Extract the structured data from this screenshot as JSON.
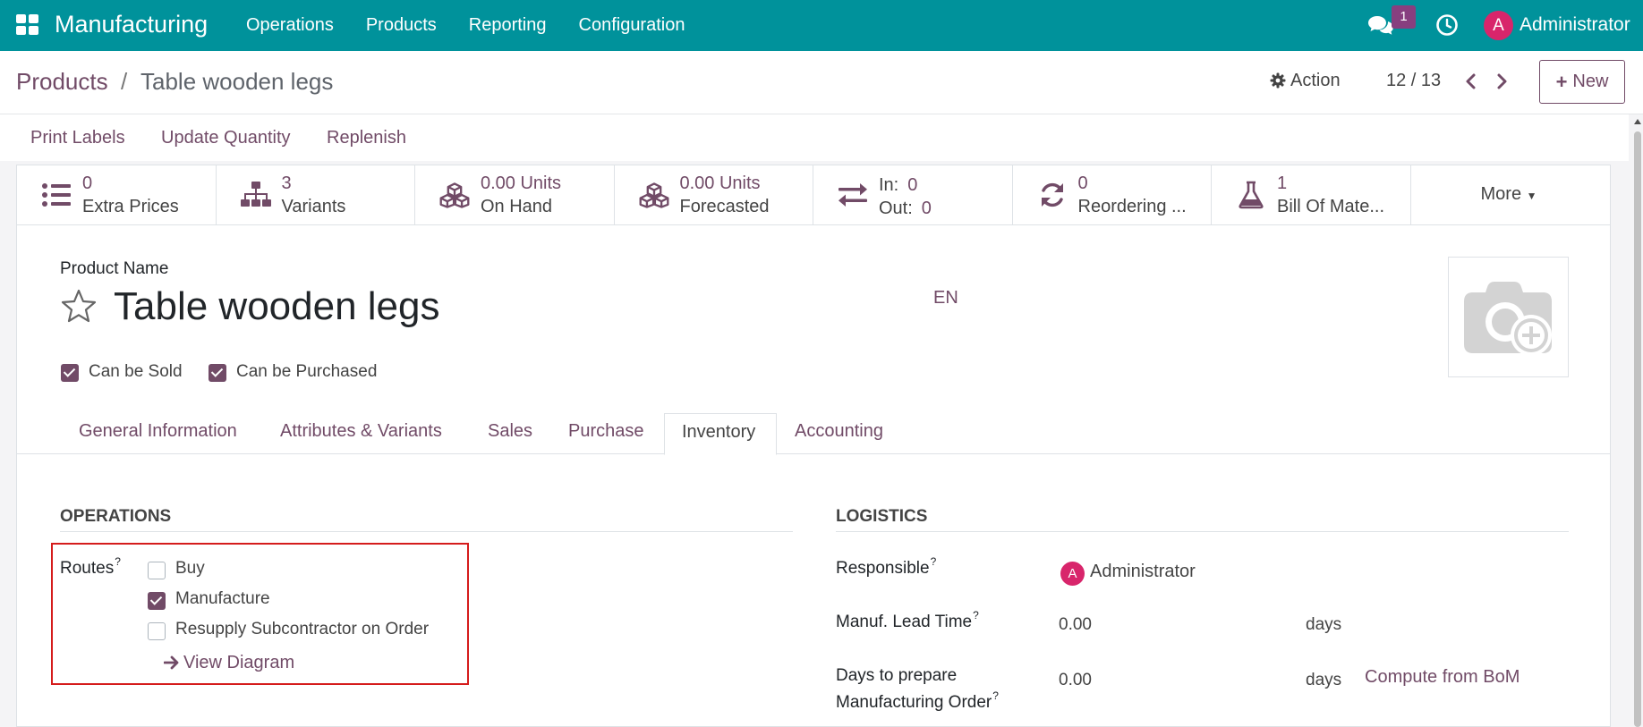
{
  "navbar": {
    "app_name": "Manufacturing",
    "menu": [
      "Operations",
      "Products",
      "Reporting",
      "Configuration"
    ],
    "chat_badge": "1",
    "avatar_letter": "A",
    "user_name": "Administrator",
    "bg_color": "#00929b"
  },
  "breadcrumb": {
    "parent": "Products",
    "separator": "/",
    "current": "Table wooden legs"
  },
  "controls": {
    "action_label": "Action",
    "pager": "12 / 13",
    "new_label": "New"
  },
  "statusbar": {
    "buttons": [
      "Print Labels",
      "Update Quantity",
      "Replenish"
    ]
  },
  "smart_buttons": [
    {
      "icon": "list-icon",
      "value": "0",
      "label": "Extra Prices"
    },
    {
      "icon": "sitemap-icon",
      "value": "3",
      "label": "Variants"
    },
    {
      "icon": "cubes-icon",
      "value": "0.00 Units",
      "label": "On Hand"
    },
    {
      "icon": "cubes-icon",
      "value": "0.00 Units",
      "label": "Forecasted"
    },
    {
      "icon": "exchange-icon",
      "in_label": "In:",
      "in_value": "0",
      "out_label": "Out:",
      "out_value": "0"
    },
    {
      "icon": "refresh-icon",
      "value": "0",
      "label": "Reordering ..."
    },
    {
      "icon": "flask-icon",
      "value": "1",
      "label": "Bill Of Mate..."
    },
    {
      "more_label": "More"
    }
  ],
  "product": {
    "name_label": "Product Name",
    "name": "Table wooden legs",
    "lang": "EN",
    "can_be_sold": "Can be Sold",
    "can_be_purchased": "Can be Purchased"
  },
  "tabs": [
    "General Information",
    "Attributes & Variants",
    "Sales",
    "Purchase",
    "Inventory",
    "Accounting"
  ],
  "active_tab": "Inventory",
  "operations": {
    "title": "OPERATIONS",
    "routes_label": "Routes",
    "help_mark": "?",
    "routes": [
      {
        "label": "Buy",
        "checked": false
      },
      {
        "label": "Manufacture",
        "checked": true
      },
      {
        "label": "Resupply Subcontractor on Order",
        "checked": false
      }
    ],
    "view_diagram": "View Diagram"
  },
  "logistics": {
    "title": "LOGISTICS",
    "responsible_label": "Responsible",
    "responsible_value": "Administrator",
    "responsible_avatar": "A",
    "lead_time_label": "Manuf. Lead Time",
    "lead_time_value": "0.00",
    "days": "days",
    "prepare_label_1": "Days to prepare",
    "prepare_label_2": "Manufacturing Order",
    "prepare_value": "0.00",
    "compute_link": "Compute from BoM"
  }
}
